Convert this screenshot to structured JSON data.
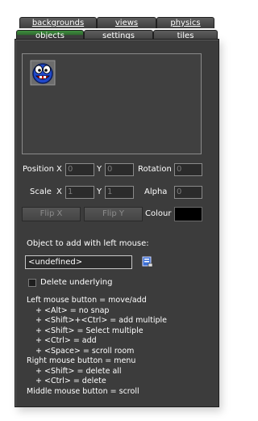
{
  "tabs": {
    "backgrounds": "backgrounds",
    "views": "views",
    "physics": "physics",
    "objects": "objects",
    "settings": "settings",
    "tiles": "tiles"
  },
  "transform": {
    "position_label": "Position",
    "x_label": "X",
    "y_label": "Y",
    "position_x": "0",
    "position_y": "0",
    "rotation_label": "Rotation",
    "rotation": "0",
    "scale_label": "Scale",
    "scale_x": "1",
    "scale_y": "1",
    "alpha_label": "Alpha",
    "alpha": "0",
    "flip_x": "Flip X",
    "flip_y": "Flip Y",
    "colour_label": "Colour",
    "colour_value": "#000000"
  },
  "object_select": {
    "prompt": "Object to add with left mouse:",
    "value": "<undefined>",
    "delete_underlying": "Delete underlying"
  },
  "help_lines": [
    "Left mouse button = move/add",
    "+ <Alt> = no snap",
    "+ <Shift>+<Ctrl> = add multiple",
    "+ <Shift> = Select multiple",
    "+ <Ctrl> = add",
    "+ <Space> = scroll room",
    "Right mouse button = menu",
    "+ <Shift> = delete all",
    "+ <Ctrl> = delete",
    "Middle mouse button = scroll"
  ],
  "colors": {
    "active_tab": "#3f8f3f",
    "panel_bg": "#3c3c3c"
  }
}
